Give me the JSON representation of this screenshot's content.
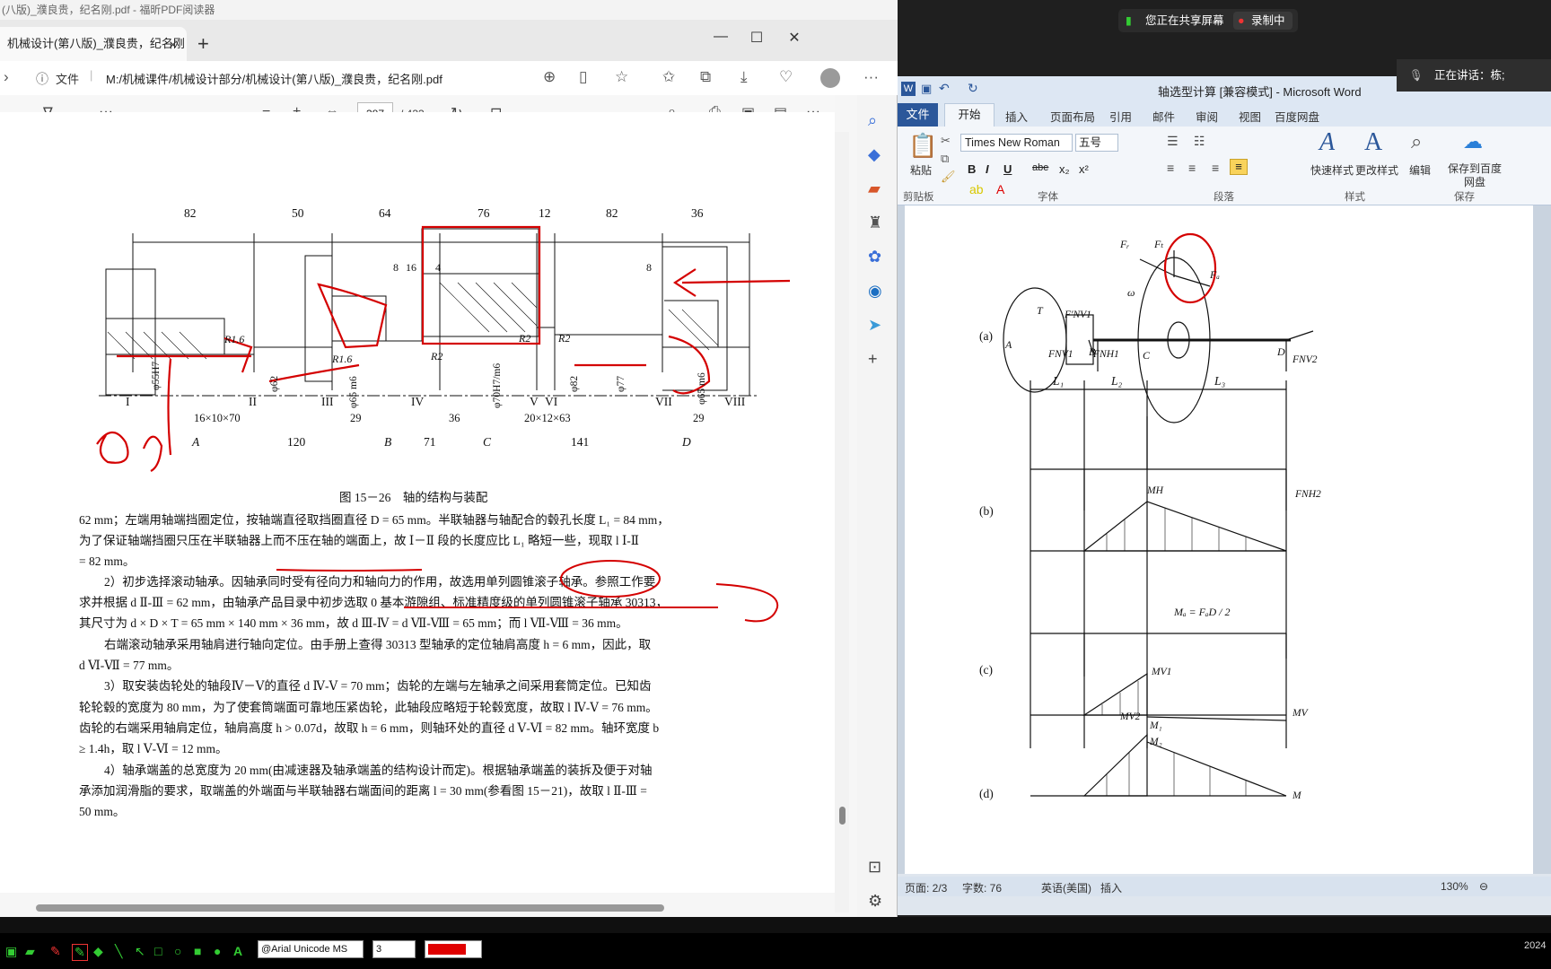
{
  "foxit_title": "(八版)_濮良贵，纪名刚.pdf - 福昕PDF阅读器",
  "browser": {
    "tab_title": "机械设计(第八版)_濮良贵，纪名刚",
    "tab_close": "×",
    "new_tab": "+",
    "win_minimize": "—",
    "win_maximize": "☐",
    "win_close": "✕",
    "address_label": "文件",
    "address_url": "M:/机械课件/机械设计部分/机械设计(第八版)_濮良贵，纪名刚.pdf"
  },
  "pdf_toolbar": {
    "zoom_out": "−",
    "zoom_in": "+",
    "page_current": "387",
    "page_total": "/ 433",
    "more": "···"
  },
  "pdf_page": {
    "figure_caption": "图 15－26　轴的结构与装配",
    "dims_top": [
      "82",
      "50",
      "64",
      "76",
      "12",
      "82",
      "36"
    ],
    "dims_inner": [
      "8",
      "16",
      "4",
      "8"
    ],
    "dims_bottom": [
      "120",
      "71",
      "141",
      "29",
      "36",
      "29"
    ],
    "keys": [
      "16×10×70",
      "20×12×63"
    ],
    "points": [
      "A",
      "B",
      "C",
      "D"
    ],
    "sections": [
      "I",
      "II",
      "III",
      "IV",
      "V",
      "VI",
      "VII",
      "VIII"
    ],
    "radii": [
      "R1.6",
      "R1.6",
      "R2",
      "R2",
      "R2"
    ],
    "diameters": [
      "φ55H7",
      "φ62",
      "φ65 m6",
      "φ70H7/m6",
      "φ82",
      "φ77",
      "φ65 m6"
    ],
    "paragraphs": [
      "62 mm；左端用轴端挡圈定位，按轴端直径取挡圈直径 D = 65 mm。半联轴器与轴配合的毂孔长度 L₁ = 84 mm，",
      "为了保证轴端挡圈只压在半联轴器上而不压在轴的端面上，故 Ⅰ－Ⅱ 段的长度应比 L₁ 略短一些，现取 l Ⅰ-Ⅱ",
      "= 82 mm。",
      "2）初步选择滚动轴承。因轴承同时受有径向力和轴向力的作用，故选用单列圆锥滚子轴承。参照工作要",
      "求并根据 d Ⅱ-Ⅲ = 62 mm，由轴承产品目录中初步选取 0 基本游隙组、标准精度级的单列圆锥滚子轴承 30313，",
      "其尺寸为 d × D × T = 65 mm × 140 mm × 36 mm，故 d Ⅲ-Ⅳ = d Ⅶ-Ⅷ = 65 mm；而 l Ⅶ-Ⅷ = 36 mm。",
      "右端滚动轴承采用轴肩进行轴向定位。由手册上查得 30313 型轴承的定位轴肩高度 h = 6 mm，因此，取",
      "d Ⅵ-Ⅶ = 77 mm。",
      "3）取安装齿轮处的轴段Ⅳ－Ⅴ的直径 d Ⅳ-Ⅴ = 70 mm；齿轮的左端与左轴承之间采用套筒定位。已知齿",
      "轮轮毂的宽度为 80 mm，为了使套筒端面可靠地压紧齿轮，此轴段应略短于轮毂宽度，故取 l Ⅳ-Ⅴ = 76 mm。",
      "齿轮的右端采用轴肩定位，轴肩高度 h > 0.07d，故取 h = 6 mm，则轴环处的直径 d Ⅴ-Ⅵ = 82 mm。轴环宽度 b",
      "≥ 1.4h，取 l Ⅴ-Ⅵ = 12 mm。",
      "4）轴承端盖的总宽度为 20 mm(由减速器及轴承端盖的结构设计而定)。根据轴承端盖的装拆及便于对轴",
      "承添加润滑脂的要求，取端盖的外端面与半联轴器右端面间的距离 l = 30 mm(参看图 15－21)，故取 l Ⅱ-Ⅲ =",
      "50 mm。"
    ]
  },
  "word": {
    "title": "轴选型计算 [兼容模式] - Microsoft Word",
    "tabs": [
      "文件",
      "开始",
      "插入",
      "页面布局",
      "引用",
      "邮件",
      "审阅",
      "视图",
      "百度网盘"
    ],
    "clipboard": {
      "paste": "粘贴",
      "label": "剪贴板"
    },
    "font": {
      "name": "Times New Roman",
      "size": "五号",
      "label": "字体"
    },
    "paragraph_label": "段落",
    "styles": {
      "quick": "快速样式",
      "change": "更改样式",
      "label": "样式"
    },
    "edit_label": "编辑",
    "save_baidu": "保存到百度网盘",
    "save_label": "保存",
    "format_buttons": [
      "B",
      "I",
      "U",
      "abe",
      "x₂",
      "x²"
    ],
    "status": {
      "page": "页面: 2/3",
      "words": "字数: 76",
      "lang": "英语(美国)",
      "mode": "插入",
      "zoom": "130%"
    },
    "diagram": {
      "parts": [
        "(a)",
        "(b)",
        "(c)",
        "(d)"
      ],
      "lengths": [
        "L₁",
        "L₂",
        "L₃"
      ],
      "points": [
        "A",
        "B",
        "C",
        "D"
      ],
      "forces": [
        "Fₜ",
        "Fᵣ",
        "Fₐ",
        "F'NV1",
        "FNV1",
        "FNH1",
        "FNH2",
        "FNV2",
        "MH",
        "MV",
        "MV1",
        "MV2",
        "M₁",
        "M₂",
        "M",
        "T",
        "ω"
      ],
      "moment_formula": "Mₐ = FₐD / 2"
    }
  },
  "overlays": {
    "sharing": "您正在共享屏幕",
    "recording": "录制中",
    "speaking": "正在讲话：栋;"
  },
  "drawbar": {
    "font": "@Arial Unicode MS",
    "width": "3",
    "color": "#e00000",
    "clock": "2024"
  }
}
